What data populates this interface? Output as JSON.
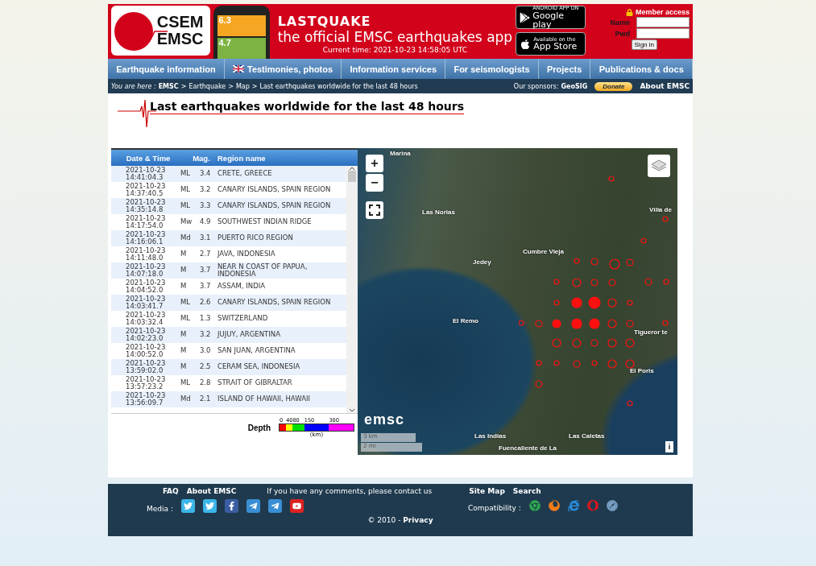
{
  "header": {
    "logo_top": "CSEM",
    "logo_bottom": "EMSC",
    "phone_values": [
      "6.3",
      "4.7"
    ],
    "app_title": "LASTQUAKE",
    "app_subtitle": "the official EMSC earthquakes app",
    "current_time": "Current time: 2021-10-23 14:58:05 UTC",
    "stores": [
      {
        "kind": "google",
        "small": "ANDROID APP ON",
        "big": "Google play"
      },
      {
        "kind": "apple",
        "small": "Available on the",
        "big": "App Store"
      }
    ],
    "member": {
      "title": "Member access",
      "fields": [
        {
          "label": "Name"
        },
        {
          "label": "Pwd"
        }
      ],
      "button": "Sign in"
    }
  },
  "nav": [
    {
      "label": "Earthquake information"
    },
    {
      "label": "Testimonies, photos",
      "kind": "flagged"
    },
    {
      "label": "Information services"
    },
    {
      "label": "For seismologists"
    },
    {
      "label": "Projects"
    },
    {
      "label": "Publications & docs"
    }
  ],
  "breadcrumb": {
    "prefix": "You are here :",
    "separator": ">",
    "crumbs": [
      "EMSC",
      "Earthquake",
      "Map",
      "Last earthquakes worldwide for the last 48 hours"
    ],
    "sponsors_label": "Our sponsors:",
    "sponsor": "GeoSIG",
    "donate": "Donate",
    "about": "About EMSC"
  },
  "title": "Last earthquakes worldwide for the last 48 hours",
  "table": {
    "columns": [
      "Date & Time",
      "Mag.",
      "Region name"
    ],
    "rows": [
      {
        "date": "2021-10-23",
        "time": "14:41:04.3",
        "type": "ML",
        "mag": "3.4",
        "region": "CRETE, GREECE"
      },
      {
        "date": "2021-10-23",
        "time": "14:37:40.5",
        "type": "ML",
        "mag": "3.2",
        "region": "CANARY ISLANDS, SPAIN REGION"
      },
      {
        "date": "2021-10-23",
        "time": "14:35:14.8",
        "type": "ML",
        "mag": "3.3",
        "region": "CANARY ISLANDS, SPAIN REGION"
      },
      {
        "date": "2021-10-23",
        "time": "14:17:54.0",
        "type": "Mw",
        "mag": "4.9",
        "region": "SOUTHWEST INDIAN RIDGE"
      },
      {
        "date": "2021-10-23",
        "time": "14:16:06.1",
        "type": "Md",
        "mag": "3.1",
        "region": "PUERTO RICO REGION"
      },
      {
        "date": "2021-10-23",
        "time": "14:11:48.0",
        "type": "M",
        "mag": "2.7",
        "region": "JAVA, INDONESIA"
      },
      {
        "date": "2021-10-23",
        "time": "14:07:18.0",
        "type": "M",
        "mag": "3.7",
        "region": "NEAR N COAST OF PAPUA, INDONESIA"
      },
      {
        "date": "2021-10-23",
        "time": "14:04:52.0",
        "type": "M",
        "mag": "3.7",
        "region": "ASSAM, INDIA"
      },
      {
        "date": "2021-10-23",
        "time": "14:03:41.7",
        "type": "ML",
        "mag": "2.6",
        "region": "CANARY ISLANDS, SPAIN REGION"
      },
      {
        "date": "2021-10-23",
        "time": "14:03:32.4",
        "type": "ML",
        "mag": "1.3",
        "region": "SWITZERLAND"
      },
      {
        "date": "2021-10-23",
        "time": "14:02:23.0",
        "type": "M",
        "mag": "3.2",
        "region": "JUJUY, ARGENTINA"
      },
      {
        "date": "2021-10-23",
        "time": "14:00:52.0",
        "type": "M",
        "mag": "3.0",
        "region": "SAN JUAN, ARGENTINA"
      },
      {
        "date": "2021-10-23",
        "time": "13:59:02.0",
        "type": "M",
        "mag": "2.5",
        "region": "CERAM SEA, INDONESIA"
      },
      {
        "date": "2021-10-23",
        "time": "13:57:23.2",
        "type": "ML",
        "mag": "2.8",
        "region": "STRAIT OF GIBRALTAR"
      },
      {
        "date": "2021-10-23",
        "time": "13:56:09.7",
        "type": "Md",
        "mag": "2.1",
        "region": "ISLAND OF HAWAII, HAWAII"
      }
    ]
  },
  "depth": {
    "label": "Depth",
    "unit": "(km)",
    "segments": [
      {
        "tick": "0",
        "color": "#ff0000"
      },
      {
        "tick": "40",
        "color": "#ffff00"
      },
      {
        "tick": "80",
        "color": "#00e000"
      },
      {
        "tick": "150",
        "color": "#0000ff"
      },
      {
        "tick": "300",
        "color": "#ff00ff"
      }
    ]
  },
  "map": {
    "zoom_in": "+",
    "zoom_out": "−",
    "logo": "emsc",
    "scale": [
      "3 km",
      "2 mi"
    ],
    "info": "i",
    "labels": [
      "Marina",
      "Las Norias",
      "Villa de",
      "Cumbre Vieja",
      "Jedey",
      "El Remo",
      "Tigueror te",
      "El Poris",
      "Las Indias",
      "Las Caletas",
      "Fuencaliente de La"
    ]
  },
  "footer": {
    "links_left": [
      "FAQ",
      "About EMSC"
    ],
    "comment": "If you have any comments, please contact us",
    "links_right": [
      "Site Map",
      "Search"
    ],
    "media_label": "Media :",
    "compat_label": "Compatibility :",
    "copyright": "© 2010 - **Privacy**"
  }
}
